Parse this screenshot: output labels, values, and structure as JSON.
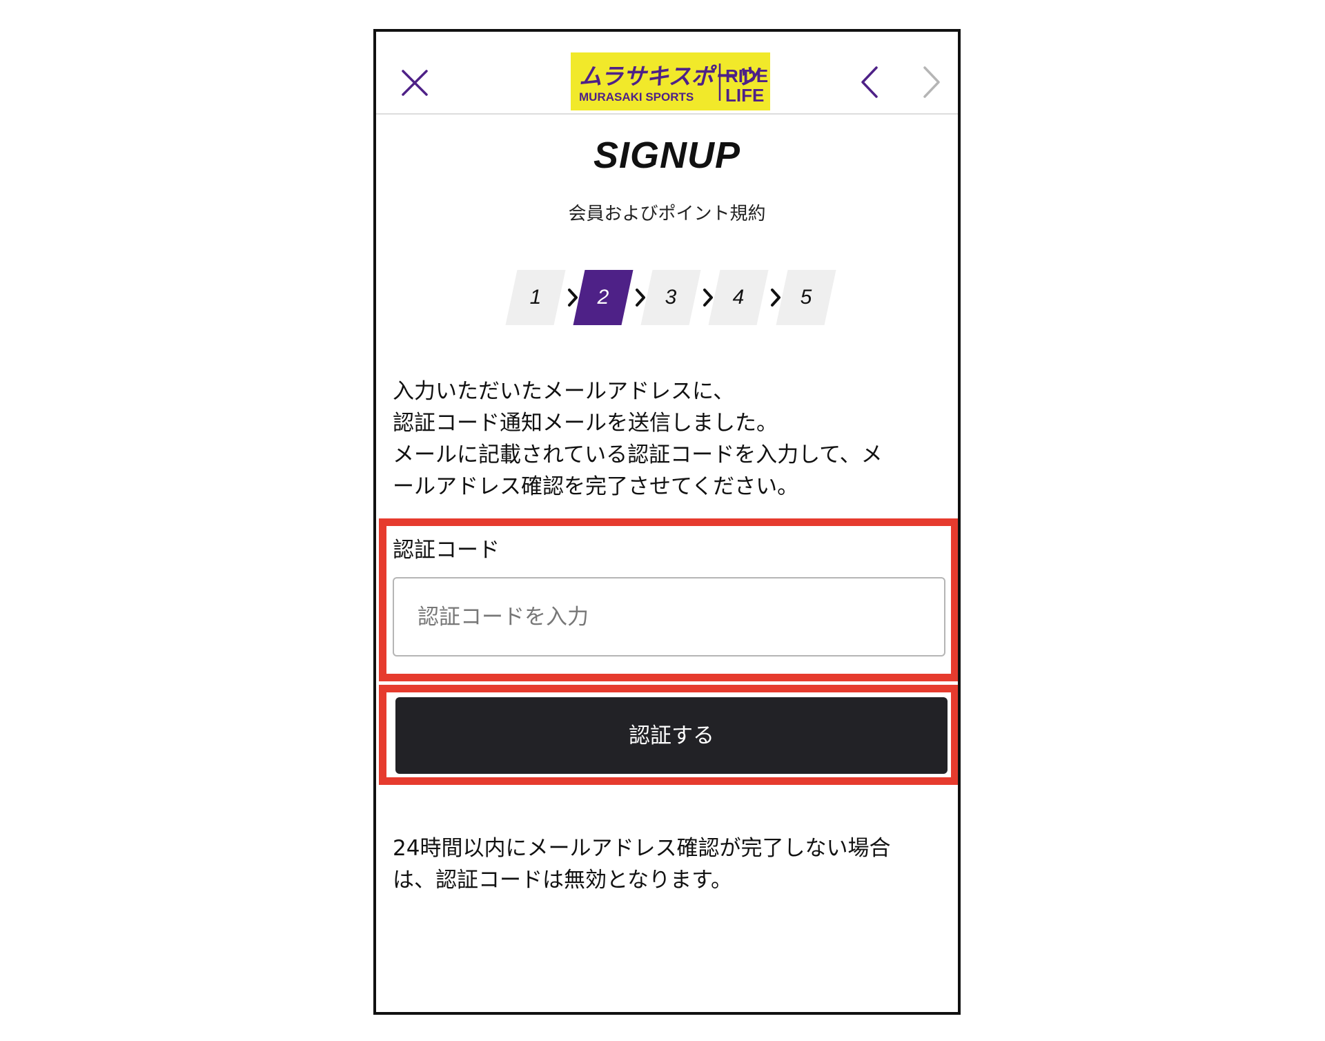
{
  "header": {
    "close_icon": "close-icon",
    "logo_text": "ムラサキスポーツ MURASAKI SPORTS RIDE LIFE",
    "logo_color": "#f1e92a",
    "back_icon": "chevron-left-icon",
    "forward_icon": "chevron-right-icon",
    "accent_color": "#4e2187"
  },
  "page": {
    "title": "SIGNUP",
    "subtitle": "会員およびポイント規約"
  },
  "steps": {
    "items": [
      "1",
      "2",
      "3",
      "4",
      "5"
    ],
    "current": 2,
    "active_color": "#4e2187"
  },
  "message": {
    "lines": [
      "入力いただいたメールアドレスに、",
      "認証コード通知メールを送信しました。",
      "メールに記載されている認証コードを入力して、メ",
      "ールアドレス確認を完了させてください。"
    ]
  },
  "form": {
    "code_label": "認証コード",
    "code_placeholder": "認証コードを入力",
    "code_value": "",
    "submit_label": "認証する",
    "highlight_color": "#e63b2e"
  },
  "note": {
    "lines": [
      "24時間以内にメールアドレス確認が完了しない場合",
      "は、認証コードは無効となります。"
    ]
  }
}
